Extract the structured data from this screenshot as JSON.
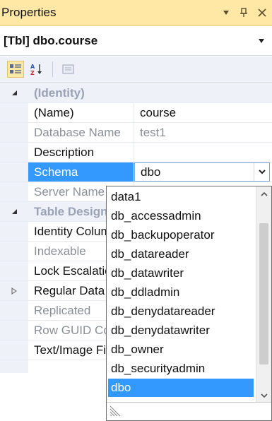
{
  "window": {
    "title": "Properties",
    "controls": [
      "dropdown-arrow",
      "pin",
      "close"
    ]
  },
  "object_selector": {
    "text": "[Tbl] dbo.course"
  },
  "toolbar": {
    "buttons": [
      "categorized-icon",
      "alphabetical-icon",
      "property-pages-icon"
    ]
  },
  "grid": {
    "rows": [
      {
        "type": "category",
        "label": "(Identity)"
      },
      {
        "type": "prop",
        "name": "(Name)",
        "value": "course"
      },
      {
        "type": "prop",
        "name": "Database Name",
        "value": "test1",
        "dim": true
      },
      {
        "type": "prop",
        "name": "Description",
        "value": ""
      },
      {
        "type": "prop",
        "name": "Schema",
        "value": "dbo",
        "selected": true
      },
      {
        "type": "prop",
        "name": "Server Name",
        "value": "",
        "dim": true
      },
      {
        "type": "category",
        "label": "Table Designer"
      },
      {
        "type": "prop",
        "name": "Identity Column",
        "value": ""
      },
      {
        "type": "prop",
        "name": "Indexable",
        "value": "",
        "dim": true
      },
      {
        "type": "prop",
        "name": "Lock Escalation",
        "value": ""
      },
      {
        "type": "collapsed",
        "name": "Regular Data Space",
        "value": ""
      },
      {
        "type": "prop",
        "name": "Replicated",
        "value": "",
        "dim": true
      },
      {
        "type": "prop",
        "name": "Row GUID Column",
        "value": "",
        "dim": true
      },
      {
        "type": "prop",
        "name": "Text/Image Filegroup",
        "value": ""
      }
    ]
  },
  "dropdown": {
    "options": [
      "data1",
      "db_accessadmin",
      "db_backupoperator",
      "db_datareader",
      "db_datawriter",
      "db_ddladmin",
      "db_denydatareader",
      "db_denydatawriter",
      "db_owner",
      "db_securityadmin",
      "dbo"
    ],
    "selected": "dbo"
  },
  "colors": {
    "title_bg": "#ffe8a6",
    "selection": "#3399ff",
    "gutter": "#eef1f8"
  }
}
